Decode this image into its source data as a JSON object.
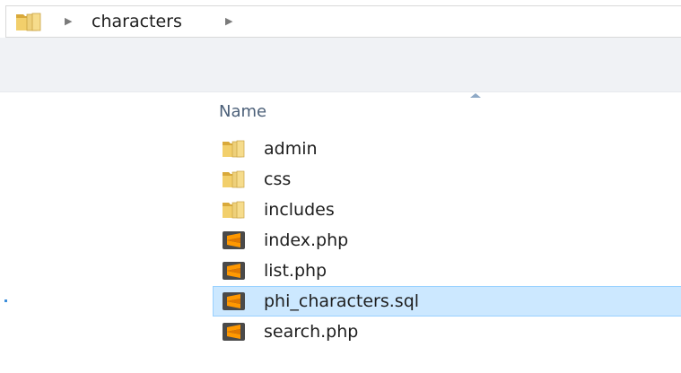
{
  "address_bar": {
    "folder_icon": "folder-icon",
    "chevron_icon": "chevron-right-icon",
    "crumb": "characters"
  },
  "file_list": {
    "column_header": "Name",
    "sort_icon": "sort-ascending-icon",
    "items": [
      {
        "name": "admin",
        "icon": "folder-icon",
        "type": "folder"
      },
      {
        "name": "css",
        "icon": "folder-icon",
        "type": "folder"
      },
      {
        "name": "includes",
        "icon": "folder-icon",
        "type": "folder"
      },
      {
        "name": "index.php",
        "icon": "sublime-text-file-icon",
        "type": "file"
      },
      {
        "name": "list.php",
        "icon": "sublime-text-file-icon",
        "type": "file"
      },
      {
        "name": "phi_characters.sql",
        "icon": "sublime-text-file-icon",
        "type": "file",
        "selected": true
      },
      {
        "name": "search.php",
        "icon": "sublime-text-file-icon",
        "type": "file"
      }
    ]
  },
  "colors": {
    "selection_bg": "#cce8ff",
    "selection_border": "#99d1ff",
    "toolbar_bg": "#f0f2f5",
    "header_text": "#4c6079",
    "folder_yellow": "#e8c25a",
    "sublime_orange": "#ff9800",
    "sublime_dark": "#4a4a4a"
  }
}
